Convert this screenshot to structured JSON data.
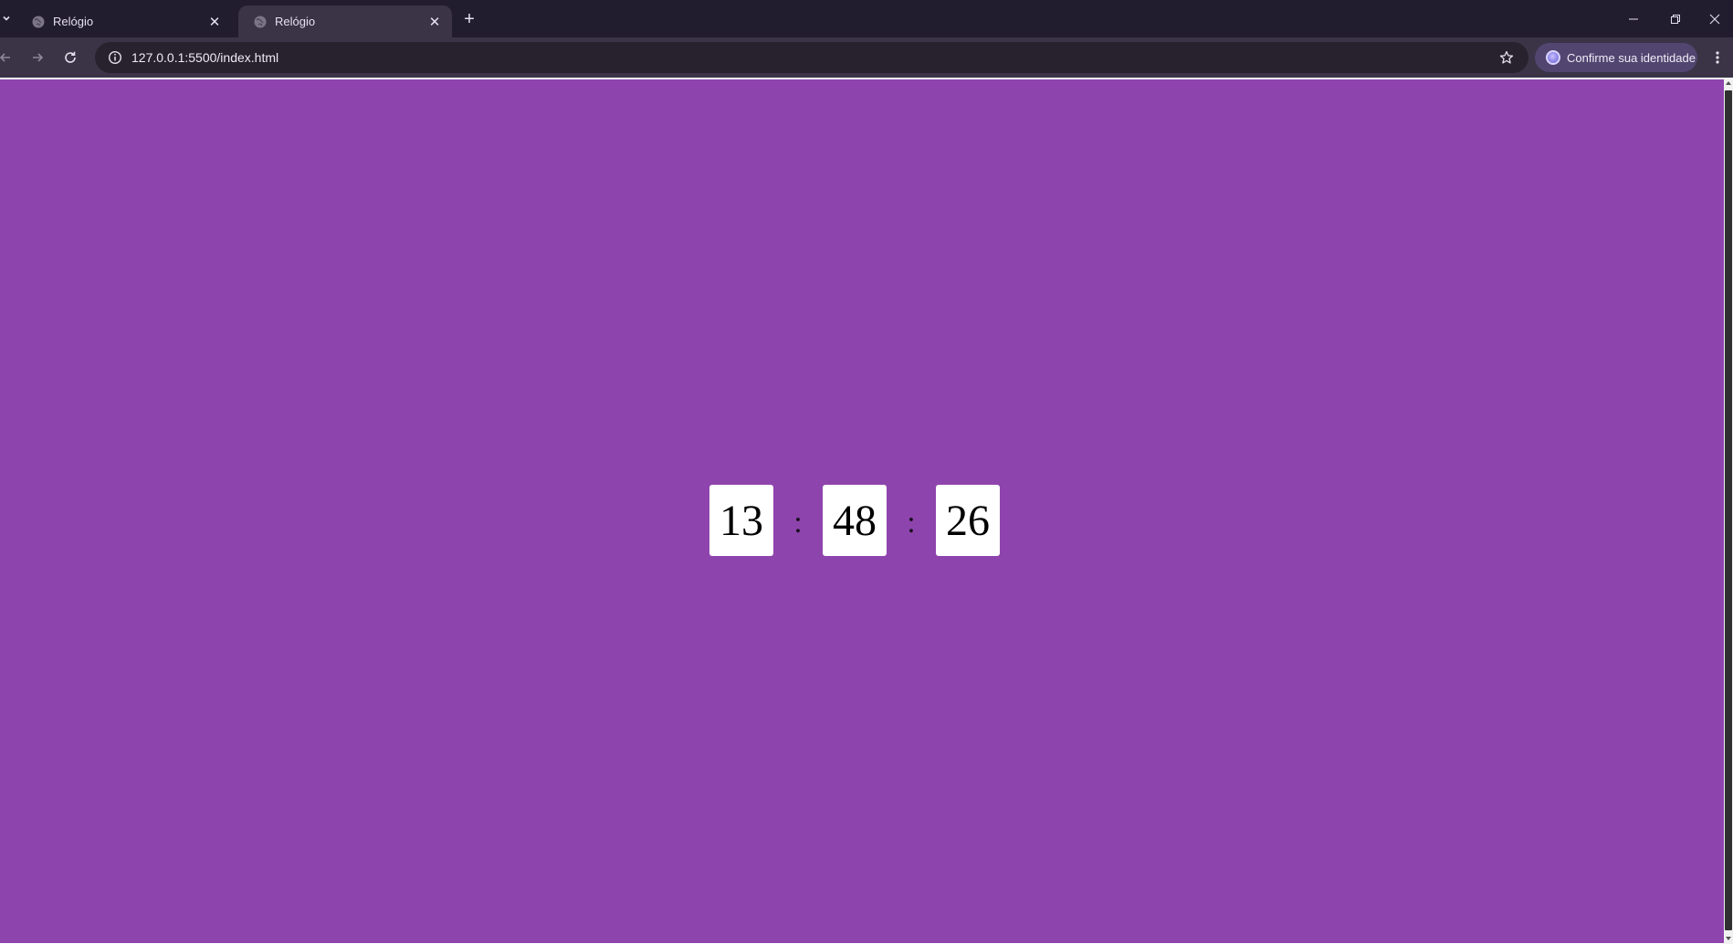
{
  "browser": {
    "tabs": [
      {
        "title": "Relógio",
        "active": false
      },
      {
        "title": "Relógio",
        "active": true
      }
    ],
    "new_tab_glyph": "+",
    "close_glyph": "✕",
    "address_bar": {
      "url": "127.0.0.1:5500/index.html"
    },
    "profile_chip": {
      "label": "Confirme sua identidade"
    },
    "icons": {
      "tab_search": "chevron-down-icon",
      "favicon": "globe-icon",
      "back": "arrow-left-icon",
      "forward": "arrow-right-icon",
      "reload": "reload-icon",
      "site_info": "info-icon",
      "bookmark": "star-icon",
      "menu": "kebab-menu-icon",
      "minimize": "minimize-icon",
      "restore": "restore-icon",
      "close_window": "close-icon"
    }
  },
  "page": {
    "background_color": "#8e44ad",
    "clock": {
      "hours": "13",
      "minutes": "48",
      "seconds": "26",
      "separator": ":"
    }
  }
}
